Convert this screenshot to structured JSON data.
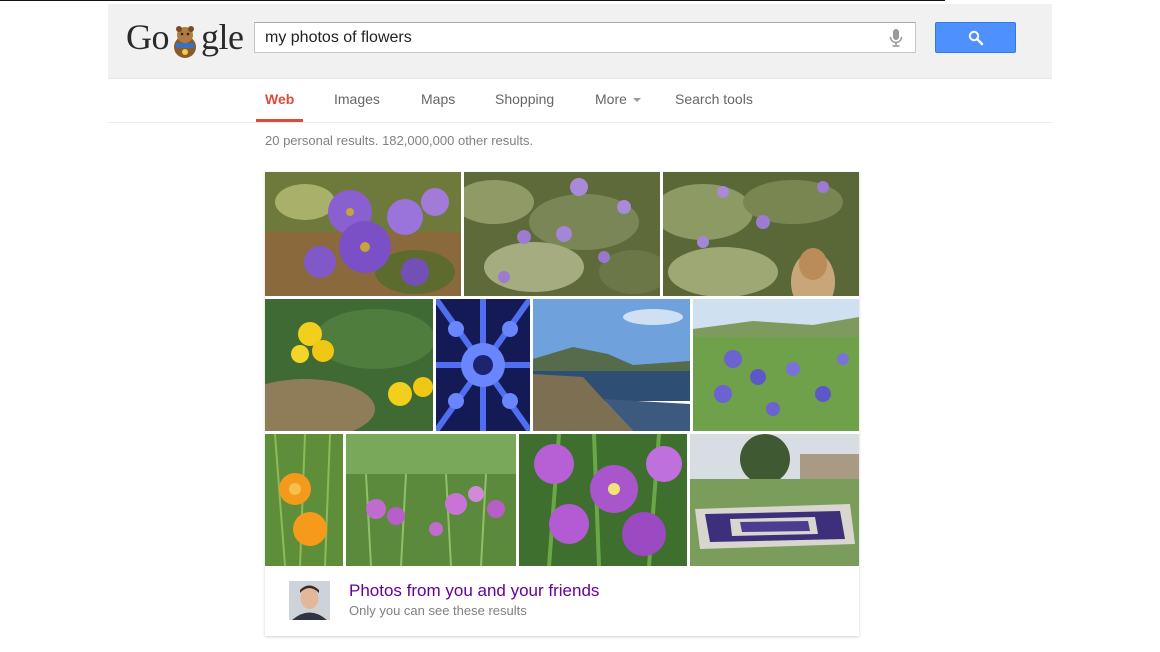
{
  "logo": {
    "part1": "Go",
    "part2": "gle"
  },
  "search": {
    "query": "my photos of flowers"
  },
  "nav": {
    "tabs": [
      {
        "label": "Web",
        "active": true
      },
      {
        "label": "Images"
      },
      {
        "label": "Maps"
      },
      {
        "label": "Shopping"
      },
      {
        "label": "More"
      },
      {
        "label": "Search tools"
      }
    ]
  },
  "results_stats": "20 personal results. 182,000,000 other results.",
  "photo_results": {
    "thumbnails": [
      "purple-tibouchina-flowers",
      "flowering-shrub-wide",
      "flowering-shrub-with-person",
      "yellow-poppies-in-ground-cover",
      "blue-kaleidoscope-flower",
      "coastal-cliffs-ocean",
      "lupine-meadow",
      "orange-california-poppies",
      "purple-iris-field",
      "purple-iris-closeup",
      "pansy-flower-bed-garden"
    ],
    "attribution": {
      "title": "Photos from you and your friends",
      "subtitle": "Only you can see these results"
    }
  },
  "colors": {
    "accent_red": "#dd4b39",
    "search_button_blue": "#4d90fe",
    "visited_purple": "#660099"
  }
}
